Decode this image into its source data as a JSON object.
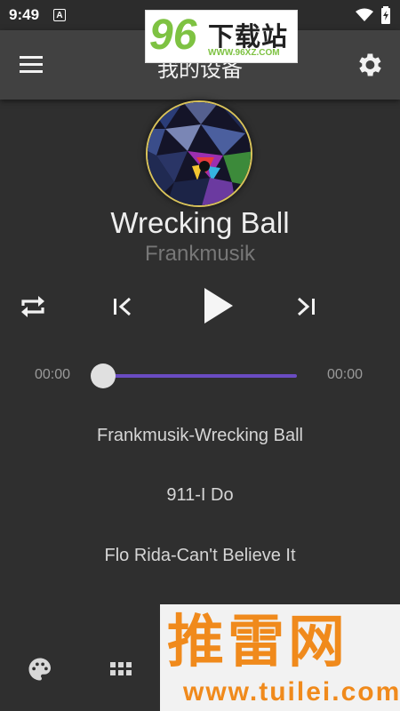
{
  "status_bar": {
    "time": "9:49",
    "notification_letter": "A"
  },
  "app_bar": {
    "title": "我的设备"
  },
  "watermark_top": {
    "number": "96",
    "text": "下载站",
    "url": "WWW.96XZ.COM"
  },
  "now_playing": {
    "title": "Wrecking Ball",
    "artist": "Frankmusik"
  },
  "controls": {
    "repeat": "repeat-icon",
    "previous": "skip-previous-icon",
    "play": "play-icon",
    "next": "skip-next-icon"
  },
  "progress": {
    "current_time": "00:00",
    "total_time": "00:00",
    "position": 0
  },
  "playlist": [
    {
      "label": "Frankmusik-Wrecking Ball"
    },
    {
      "label": "911-I Do"
    },
    {
      "label": "Flo Rida-Can't Believe It"
    }
  ],
  "bottom_nav": {
    "palette": "palette-icon",
    "grid": "grid-icon"
  },
  "watermark_bottom": {
    "text": "推雷网",
    "url": "www.tuilei.com"
  },
  "colors": {
    "background": "#2f2f2f",
    "app_bar": "#414141",
    "accent": "#6a4cc2",
    "artist_text": "#777777"
  }
}
